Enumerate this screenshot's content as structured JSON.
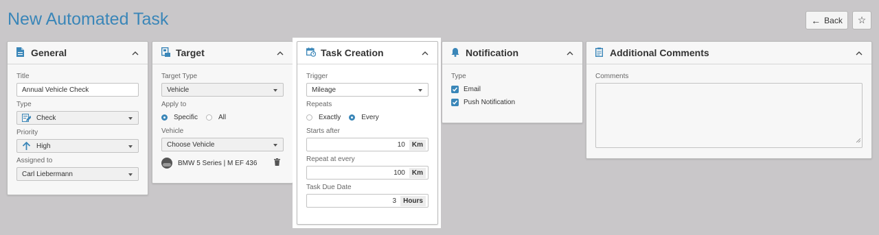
{
  "page": {
    "title": "New Automated Task",
    "back_label": "Back",
    "back_icon": "arrow-left-icon",
    "star_icon": "star-icon"
  },
  "colors": {
    "accent": "#3a86b8",
    "background": "#c9c7c9"
  },
  "general": {
    "title": "General",
    "icon": "document-icon",
    "title_label": "Title",
    "title_value": "Annual Vehicle Check",
    "type_label": "Type",
    "type_value": "Check",
    "priority_label": "Priority",
    "priority_value": "High",
    "assigned_label": "Assigned to",
    "assigned_value": "Carl Liebermann"
  },
  "target": {
    "title": "Target",
    "icon": "target-card-icon",
    "target_type_label": "Target Type",
    "target_type_value": "Vehicle",
    "apply_label": "Apply to",
    "apply_options": [
      "Specific",
      "All"
    ],
    "apply_selected": "Specific",
    "vehicle_label": "Vehicle",
    "vehicle_placeholder": "Choose Vehicle",
    "selected_vehicle": "BMW 5 Series | M EF 436"
  },
  "task_creation": {
    "title": "Task Creation",
    "icon": "calendar-clock-icon",
    "trigger_label": "Trigger",
    "trigger_value": "Mileage",
    "repeats_label": "Repeats",
    "repeats_options": [
      "Exactly",
      "Every"
    ],
    "repeats_selected": "Every",
    "starts_after_label": "Starts after",
    "starts_after_value": "10",
    "starts_after_unit": "Km",
    "repeat_every_label": "Repeat at every",
    "repeat_every_value": "100",
    "repeat_every_unit": "Km",
    "due_label": "Task Due Date",
    "due_value": "3",
    "due_unit": "Hours"
  },
  "notification": {
    "title": "Notification",
    "icon": "bell-icon",
    "type_label": "Type",
    "options": [
      "Email",
      "Push Notification"
    ]
  },
  "comments": {
    "title": "Additional Comments",
    "icon": "clipboard-icon",
    "label": "Comments",
    "value": ""
  }
}
